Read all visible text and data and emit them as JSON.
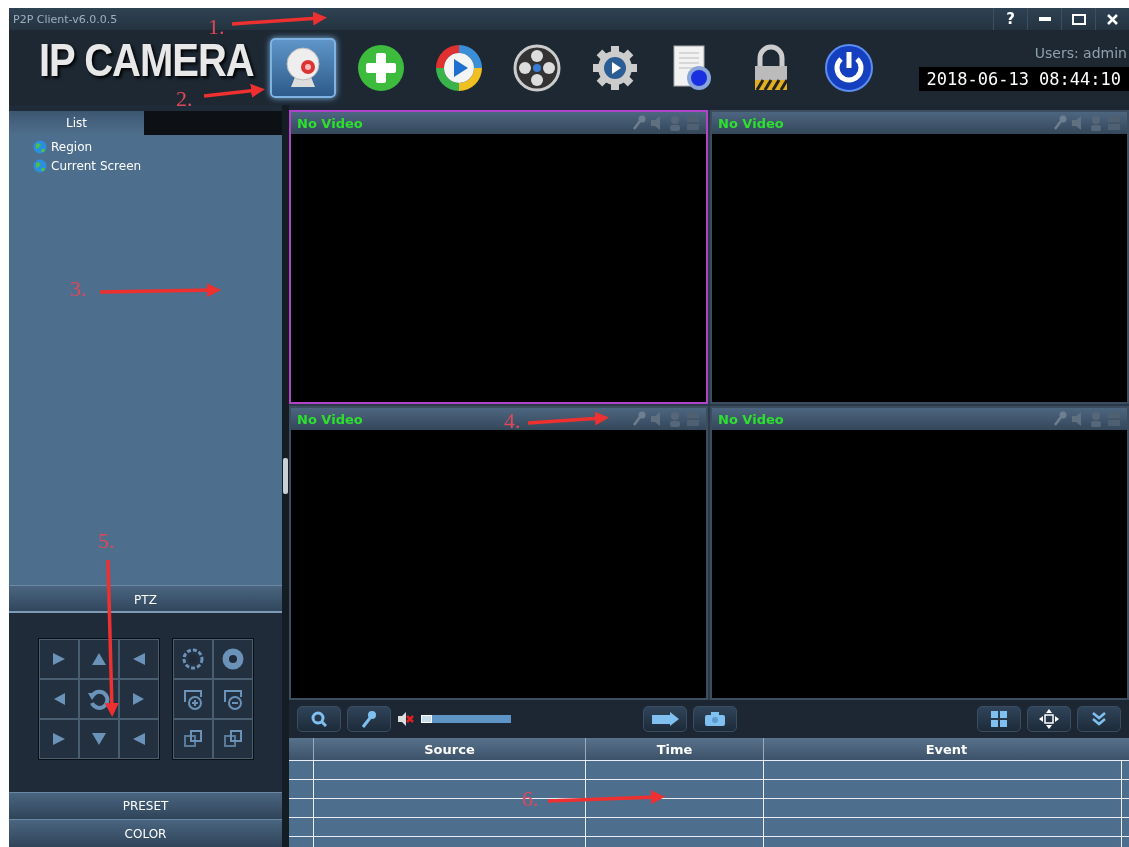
{
  "window": {
    "title": "P2P Client-v6.0.0.5",
    "help": "?"
  },
  "logo": "IP CAMERA",
  "toolbar": [
    {
      "kind": "webcam",
      "selected": true
    },
    {
      "kind": "add",
      "selected": false
    },
    {
      "kind": "play",
      "selected": false
    },
    {
      "kind": "reel",
      "selected": false
    },
    {
      "kind": "gear",
      "selected": false
    },
    {
      "kind": "document",
      "selected": false
    },
    {
      "kind": "lock",
      "selected": false
    },
    {
      "kind": "power",
      "selected": false
    }
  ],
  "user": "Users: admin",
  "datetime": "2018-06-13 08:44:10",
  "sidebar": {
    "tabs": [
      {
        "label": "List",
        "selected": true
      }
    ],
    "tree": [
      {
        "label": "Region"
      },
      {
        "label": "Current Screen"
      }
    ],
    "sections": [
      {
        "label": "PTZ",
        "expanded": true
      },
      {
        "label": "PRESET",
        "expanded": false
      },
      {
        "label": "COLOR",
        "expanded": false
      }
    ]
  },
  "videos": [
    {
      "status": "No Video",
      "selected": true
    },
    {
      "status": "No Video",
      "selected": false
    },
    {
      "status": "No Video",
      "selected": false
    },
    {
      "status": "No Video",
      "selected": false
    }
  ],
  "audio": {
    "muted": true,
    "level": 0.12
  },
  "log": {
    "columns": [
      "Source",
      "Time",
      "Event"
    ]
  },
  "annotations": [
    {
      "label": "1."
    },
    {
      "label": "2."
    },
    {
      "label": "3."
    },
    {
      "label": "4."
    },
    {
      "label": "5."
    },
    {
      "label": "6."
    }
  ]
}
